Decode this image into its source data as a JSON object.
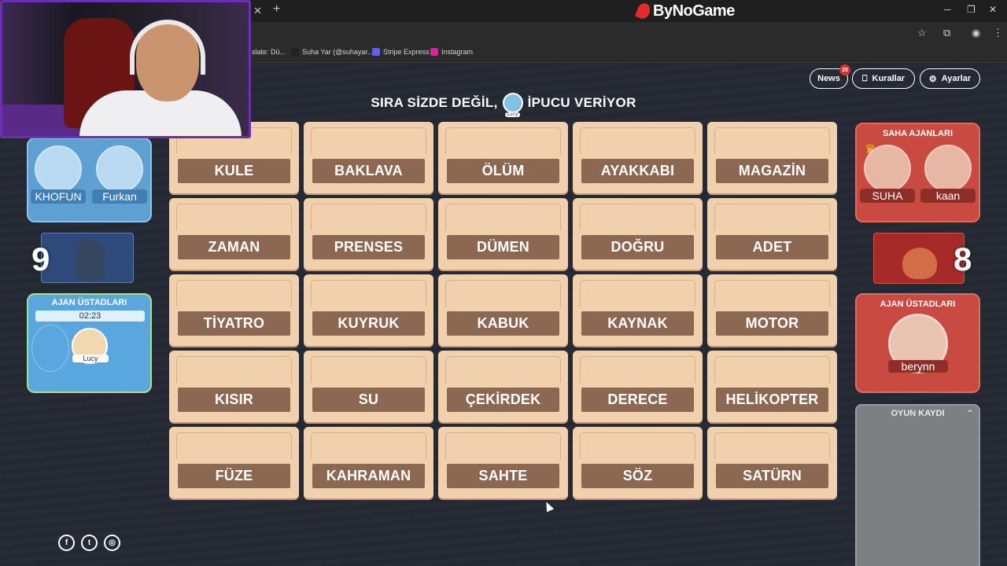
{
  "browser": {
    "brand": "ByNoGame",
    "bookmarks": [
      {
        "label": "slate: Dü...",
        "color": "#4a8af4"
      },
      {
        "label": "Suha Yar (@suhayar....",
        "color": "#222222"
      },
      {
        "label": "Stripe Express",
        "color": "#635bff"
      },
      {
        "label": "Instagram",
        "color": "#d6249f"
      }
    ]
  },
  "top_buttons": {
    "news": "News",
    "news_badge": "25",
    "rules": "Kurallar",
    "settings": "Ayarlar"
  },
  "status": {
    "prefix": "SIRA SİZDE DEĞİL,",
    "avatar_name": "Lucy",
    "suffix": "İPUCU VERİYOR"
  },
  "cards": [
    "KULE",
    "BAKLAVA",
    "ÖLÜM",
    "AYAKKABI",
    "MAGAZİN",
    "ZAMAN",
    "PRENSES",
    "DÜMEN",
    "DOĞRU",
    "ADET",
    "TİYATRO",
    "KUYRUK",
    "KABUK",
    "KAYNAK",
    "MOTOR",
    "KISIR",
    "SU",
    "ÇEKİRDEK",
    "DERECE",
    "HELİKOPTER",
    "FÜZE",
    "KAHRAMAN",
    "SAHTE",
    "SÖZ",
    "SATÜRN"
  ],
  "blue_team": {
    "operatives": [
      "KHOFUN",
      "Furkan"
    ],
    "score": "9",
    "spymasters_title": "AJAN ÜSTADLARI",
    "timer": "02:23",
    "spymaster": "Lucy",
    "color": "#5aa6de"
  },
  "red_team": {
    "operatives_title": "SAHA AJANLARI",
    "operatives": [
      "SUHA",
      "kaan"
    ],
    "score": "8",
    "spymasters_title": "AJAN ÜSTADLARI",
    "spymaster": "berynn",
    "color": "#c94a40"
  },
  "game_log": {
    "title": "OYUN KAYDI"
  },
  "socials": [
    {
      "name": "facebook-icon",
      "glyph": "f"
    },
    {
      "name": "twitter-icon",
      "glyph": "t"
    },
    {
      "name": "instagram-icon",
      "glyph": "◎"
    }
  ]
}
